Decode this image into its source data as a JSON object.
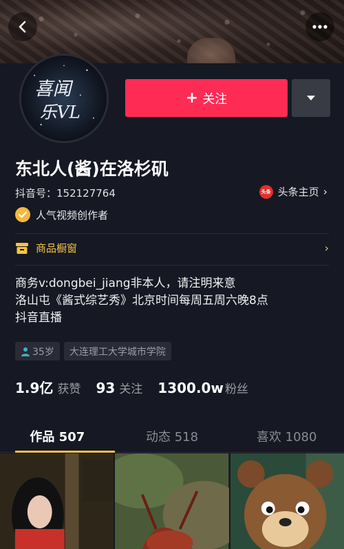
{
  "header": {
    "back_icon": "chevron-left-icon",
    "more_icon": "more-dots-icon"
  },
  "avatar": {
    "logo_text_line1": "喜闻",
    "logo_text_line2": "乐VL"
  },
  "actions": {
    "follow_label": "关注",
    "follow_plus": "+",
    "dropdown_icon": "triangle-down-icon",
    "accent_color": "#fe2c55"
  },
  "profile": {
    "name": "东北人(酱)在洛杉矶",
    "douyin_id": "抖音号：152127764",
    "toutiao_label": "头条主页",
    "toutiao_badge": "头条",
    "creator_badge": "人气视频创作者"
  },
  "shop": {
    "label": "商品橱窗",
    "color": "#f5c447"
  },
  "bio": {
    "line1": "商务v:dongbei_jiang非本人，请注明来意",
    "line2": "洛山屯《酱式综艺秀》北京时间每周五周六晚8点",
    "line3": "抖音直播"
  },
  "tags": {
    "age": "35岁",
    "school": "大连理工大学城市学院"
  },
  "stats": {
    "likes_num": "1.9亿",
    "likes_label": "获赞",
    "following_num": "93",
    "following_label": "关注",
    "followers_num": "1300.0w",
    "followers_label": "粉丝"
  },
  "tabs": [
    {
      "label": "作品 507",
      "active": true
    },
    {
      "label": "动态 518",
      "active": false
    },
    {
      "label": "喜欢 1080",
      "active": false
    }
  ]
}
